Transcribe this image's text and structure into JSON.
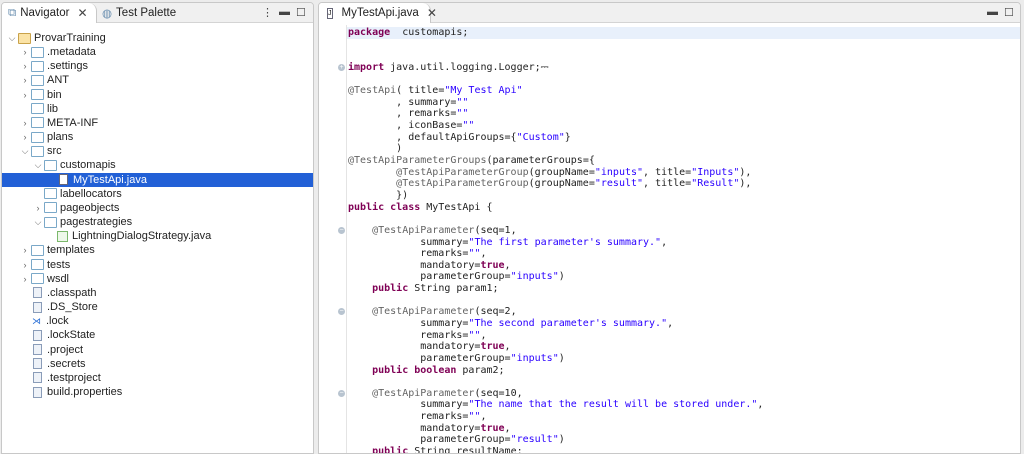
{
  "navigator": {
    "tabs": [
      {
        "label": "Navigator",
        "icon": "navigator-icon",
        "active": true
      },
      {
        "label": "Test Palette",
        "icon": "palette-icon",
        "active": false
      }
    ],
    "tree": [
      {
        "label": "ProvarTraining",
        "depth": 0,
        "type": "project",
        "expanded": true
      },
      {
        "label": ".metadata",
        "depth": 1,
        "type": "folder",
        "expandable": true
      },
      {
        "label": ".settings",
        "depth": 1,
        "type": "folder",
        "expandable": true
      },
      {
        "label": "ANT",
        "depth": 1,
        "type": "folder",
        "expandable": true
      },
      {
        "label": "bin",
        "depth": 1,
        "type": "folder",
        "expandable": true
      },
      {
        "label": "lib",
        "depth": 1,
        "type": "folder",
        "expandable": false
      },
      {
        "label": "META-INF",
        "depth": 1,
        "type": "folder",
        "expandable": true
      },
      {
        "label": "plans",
        "depth": 1,
        "type": "folder",
        "expandable": true
      },
      {
        "label": "src",
        "depth": 1,
        "type": "folder",
        "expanded": true
      },
      {
        "label": "customapis",
        "depth": 2,
        "type": "folder",
        "expanded": true
      },
      {
        "label": "MyTestApi.java",
        "depth": 3,
        "type": "java",
        "selected": true
      },
      {
        "label": "labellocators",
        "depth": 2,
        "type": "folder",
        "expandable": false
      },
      {
        "label": "pageobjects",
        "depth": 2,
        "type": "folder",
        "expandable": true
      },
      {
        "label": "pagestrategies",
        "depth": 2,
        "type": "folder",
        "expanded": true
      },
      {
        "label": "LightningDialogStrategy.java",
        "depth": 3,
        "type": "class"
      },
      {
        "label": "templates",
        "depth": 1,
        "type": "folder",
        "expandable": true
      },
      {
        "label": "tests",
        "depth": 1,
        "type": "folder",
        "expandable": true
      },
      {
        "label": "wsdl",
        "depth": 1,
        "type": "folder",
        "expandable": true
      },
      {
        "label": ".classpath",
        "depth": 1,
        "type": "file"
      },
      {
        "label": ".DS_Store",
        "depth": 1,
        "type": "file"
      },
      {
        "label": ".lock",
        "depth": 1,
        "type": "vscode"
      },
      {
        "label": ".lockState",
        "depth": 1,
        "type": "file"
      },
      {
        "label": ".project",
        "depth": 1,
        "type": "file"
      },
      {
        "label": ".secrets",
        "depth": 1,
        "type": "file"
      },
      {
        "label": ".testproject",
        "depth": 1,
        "type": "file"
      },
      {
        "label": "build.properties",
        "depth": 1,
        "type": "file"
      }
    ]
  },
  "editor": {
    "tab": "MyTestApi.java",
    "colors": {
      "keyword": "#7f0055",
      "string": "#2a00ff",
      "annotation": "#646464"
    },
    "lines": [
      {
        "cur": true,
        "s": [
          [
            "kw",
            "package"
          ],
          [
            "",
            "customapis;"
          ]
        ],
        "pre": ""
      },
      {
        "s": []
      },
      {
        "s": []
      },
      {
        "fold": "+",
        "s": [
          [
            "kw",
            "import"
          ],
          [
            "",
            " java.util.logging.Logger;"
          ],
          [
            "",
            "⎓"
          ]
        ]
      },
      {
        "s": []
      },
      {
        "s": [
          [
            "an",
            "@TestApi"
          ],
          [
            "",
            "( title="
          ],
          [
            "st",
            "\"My Test Api\""
          ]
        ]
      },
      {
        "s": [
          [
            "",
            "        , summary="
          ],
          [
            "st",
            "\"\""
          ]
        ]
      },
      {
        "s": [
          [
            "",
            "        , remarks="
          ],
          [
            "st",
            "\"\""
          ]
        ]
      },
      {
        "s": [
          [
            "",
            "        , iconBase="
          ],
          [
            "st",
            "\"\""
          ]
        ]
      },
      {
        "s": [
          [
            "",
            "        , defaultApiGroups={"
          ],
          [
            "st",
            "\"Custom\""
          ],
          [
            "",
            "}"
          ]
        ]
      },
      {
        "s": [
          [
            "",
            "        )"
          ]
        ]
      },
      {
        "s": [
          [
            "an",
            "@TestApiParameterGroups"
          ],
          [
            "",
            "(parameterGroups={"
          ]
        ]
      },
      {
        "s": [
          [
            "",
            "        "
          ],
          [
            "an",
            "@TestApiParameterGroup"
          ],
          [
            "",
            "(groupName="
          ],
          [
            "st",
            "\"inputs\""
          ],
          [
            "",
            ", title="
          ],
          [
            "st",
            "\"Inputs\""
          ],
          [
            "",
            "),"
          ]
        ]
      },
      {
        "s": [
          [
            "",
            "        "
          ],
          [
            "an",
            "@TestApiParameterGroup"
          ],
          [
            "",
            "(groupName="
          ],
          [
            "st",
            "\"result\""
          ],
          [
            "",
            ", title="
          ],
          [
            "st",
            "\"Result\""
          ],
          [
            "",
            "),"
          ]
        ]
      },
      {
        "s": [
          [
            "",
            "        })"
          ]
        ]
      },
      {
        "s": [
          [
            "kw",
            "public class"
          ],
          [
            "",
            " MyTestApi {"
          ]
        ]
      },
      {
        "s": []
      },
      {
        "fold": "-",
        "s": [
          [
            "",
            "    "
          ],
          [
            "an",
            "@TestApiParameter"
          ],
          [
            "",
            "(seq=1,"
          ]
        ]
      },
      {
        "s": [
          [
            "",
            "            summary="
          ],
          [
            "st",
            "\"The first parameter's summary.\""
          ],
          [
            "",
            ","
          ]
        ]
      },
      {
        "s": [
          [
            "",
            "            remarks="
          ],
          [
            "st",
            "\"\""
          ],
          [
            "",
            ","
          ]
        ]
      },
      {
        "s": [
          [
            "",
            "            mandatory="
          ],
          [
            "kw",
            "true"
          ],
          [
            "",
            ","
          ]
        ]
      },
      {
        "s": [
          [
            "",
            "            parameterGroup="
          ],
          [
            "st",
            "\"inputs\""
          ],
          [
            "",
            ")"
          ]
        ]
      },
      {
        "s": [
          [
            "",
            "    "
          ],
          [
            "kw",
            "public"
          ],
          [
            "",
            " String param1;"
          ]
        ]
      },
      {
        "s": []
      },
      {
        "fold": "-",
        "s": [
          [
            "",
            "    "
          ],
          [
            "an",
            "@TestApiParameter"
          ],
          [
            "",
            "(seq=2,"
          ]
        ]
      },
      {
        "s": [
          [
            "",
            "            summary="
          ],
          [
            "st",
            "\"The second parameter's summary.\""
          ],
          [
            "",
            ","
          ]
        ]
      },
      {
        "s": [
          [
            "",
            "            remarks="
          ],
          [
            "st",
            "\"\""
          ],
          [
            "",
            ","
          ]
        ]
      },
      {
        "s": [
          [
            "",
            "            mandatory="
          ],
          [
            "kw",
            "true"
          ],
          [
            "",
            ","
          ]
        ]
      },
      {
        "s": [
          [
            "",
            "            parameterGroup="
          ],
          [
            "st",
            "\"inputs\""
          ],
          [
            "",
            ")"
          ]
        ]
      },
      {
        "s": [
          [
            "",
            "    "
          ],
          [
            "kw",
            "public boolean"
          ],
          [
            "",
            " param2;"
          ]
        ]
      },
      {
        "s": []
      },
      {
        "fold": "-",
        "s": [
          [
            "",
            "    "
          ],
          [
            "an",
            "@TestApiParameter"
          ],
          [
            "",
            "(seq=10,"
          ]
        ]
      },
      {
        "s": [
          [
            "",
            "            summary="
          ],
          [
            "st",
            "\"The name that the result will be stored under.\""
          ],
          [
            "",
            ","
          ]
        ]
      },
      {
        "s": [
          [
            "",
            "            remarks="
          ],
          [
            "st",
            "\"\""
          ],
          [
            "",
            ","
          ]
        ]
      },
      {
        "s": [
          [
            "",
            "            mandatory="
          ],
          [
            "kw",
            "true"
          ],
          [
            "",
            ","
          ]
        ]
      },
      {
        "s": [
          [
            "",
            "            parameterGroup="
          ],
          [
            "st",
            "\"result\""
          ],
          [
            "",
            ")"
          ]
        ]
      },
      {
        "s": [
          [
            "",
            "    "
          ],
          [
            "kw",
            "public"
          ],
          [
            "",
            " String resultName;"
          ]
        ]
      }
    ]
  }
}
